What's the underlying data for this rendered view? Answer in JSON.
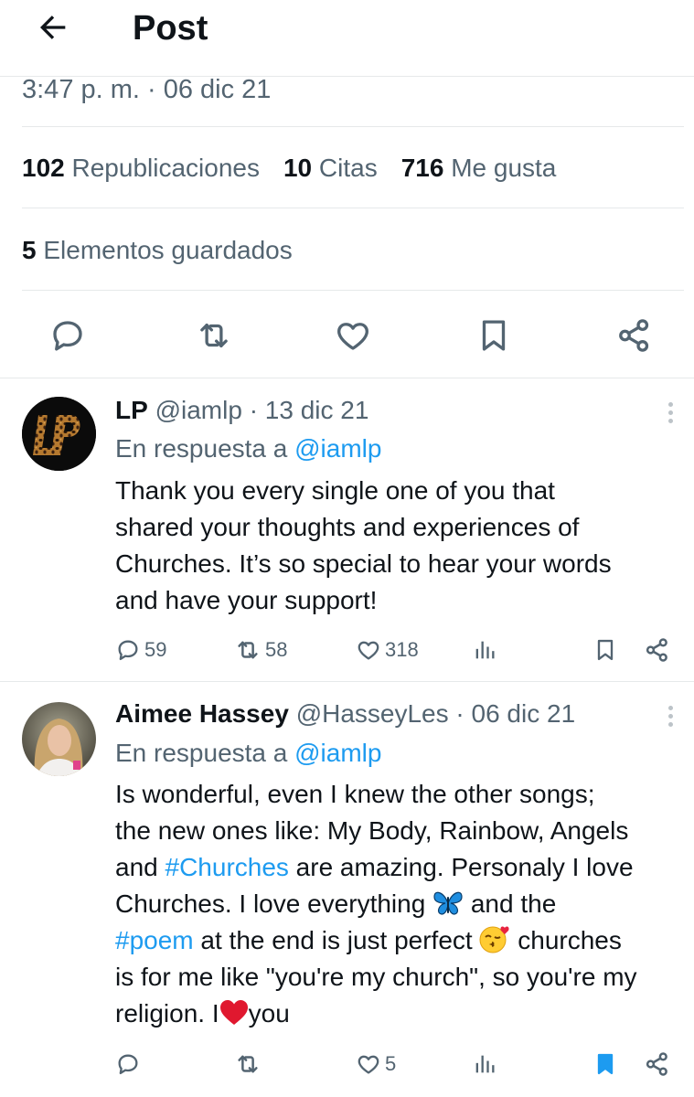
{
  "header": {
    "title": "Post"
  },
  "post": {
    "timestamp": "3:47 p. m. · 06 dic 21",
    "stats": {
      "reposts_count": "102",
      "reposts_label": "Republicaciones",
      "quotes_count": "10",
      "quotes_label": "Citas",
      "likes_count": "716",
      "likes_label": "Me gusta"
    },
    "saved": {
      "count": "5",
      "label": "Elementos guardados"
    }
  },
  "replies": [
    {
      "name": "LP",
      "handle": "@iamlp",
      "date": "· 13 dic 21",
      "in_reply_prefix": "En respuesta a ",
      "in_reply_to": "@iamlp",
      "text_lines": [
        "Thank you every single one of you that",
        "shared your thoughts and experiences of",
        "Churches. It’s so special to hear your words",
        "and have your support!"
      ],
      "counts": {
        "replies": "59",
        "reposts": "58",
        "likes": "318"
      },
      "bookmarked": false
    },
    {
      "name": "Aimee Hassey",
      "handle": "@HasseyLes",
      "date": "· 06 dic 21",
      "in_reply_prefix": "En respuesta a ",
      "in_reply_to": "@iamlp",
      "text": {
        "l1": "Is wonderful, even I knew the other songs;",
        "l2": "the new ones like: My Body, Rainbow, Angels",
        "l3_pre": "and ",
        "l3_tag": "#Churches",
        "l3_post": " are amazing. Personaly I love",
        "l4_pre": "Churches. I love everything ",
        "l4_post": " and the",
        "l5_tag": "#poem",
        "l5_mid": " at the end is just perfect ",
        "l5_post": " churches",
        "l6": "is for me like \"you're my church\", so you're my",
        "l7_pre": "religion. I",
        "l7_post": "you"
      },
      "emojis": [
        "butterfly-emoji",
        "kissing-face-emoji",
        "red-heart-emoji"
      ],
      "counts": {
        "replies": "",
        "reposts": "",
        "likes": "5"
      },
      "bookmarked": true
    }
  ],
  "colors": {
    "accent": "#1d9bf0",
    "muted": "#536471",
    "text": "#0f1419",
    "divider": "#e6e9ea"
  }
}
